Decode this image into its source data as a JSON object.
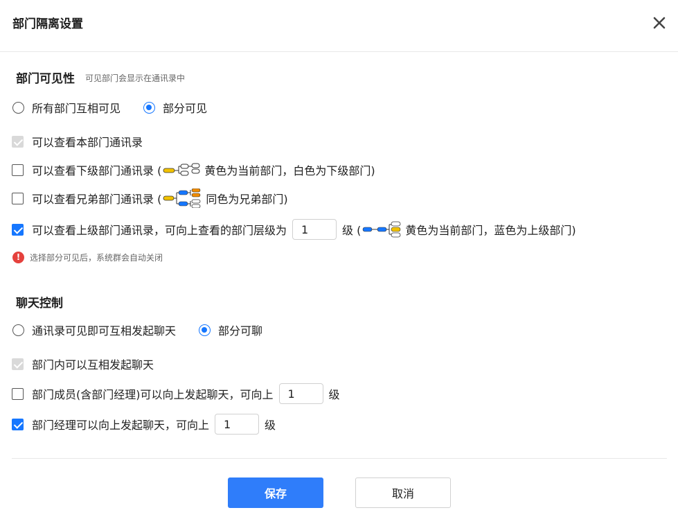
{
  "dialog": {
    "title": "部门隔离设置",
    "close_icon": "close-icon"
  },
  "visibility": {
    "title": "部门可见性",
    "hint": "可见部门会显示在通讯录中",
    "mode_options": [
      {
        "label": "所有部门互相可见",
        "checked": false
      },
      {
        "label": "部分可见",
        "checked": true
      }
    ],
    "options": {
      "own_dept": {
        "label": "可以查看本部门通讯录",
        "checked": true,
        "disabled": true
      },
      "sub_dept": {
        "label": "可以查看下级部门通讯录 (",
        "legend": "黄色为当前部门，白色为下级部门)",
        "checked": false
      },
      "sibling_dept": {
        "label": "可以查看兄弟部门通讯录 (",
        "legend": "同色为兄弟部门)",
        "checked": false
      },
      "upper_dept": {
        "label": "可以查看上级部门通讯录，可向上查看的部门层级为",
        "value": "1",
        "unit": "级 (",
        "legend": "黄色为当前部门，蓝色为上级部门)",
        "checked": true
      }
    },
    "warning": "选择部分可见后，系统群会自动关闭",
    "warning_icon": "exclamation-circle-icon"
  },
  "chat": {
    "title": "聊天控制",
    "mode_options": [
      {
        "label": "通讯录可见即可互相发起聊天",
        "checked": false
      },
      {
        "label": "部分可聊",
        "checked": true
      }
    ],
    "options": {
      "in_dept": {
        "label": "部门内可以互相发起聊天",
        "checked": true,
        "disabled": true
      },
      "member_up": {
        "label": "部门成员(含部门经理)可以向上发起聊天，可向上",
        "value": "1",
        "unit": "级",
        "checked": false
      },
      "manager_up": {
        "label": "部门经理可以向上发起聊天，可向上",
        "value": "1",
        "unit": "级",
        "checked": true
      }
    }
  },
  "footer": {
    "save_label": "保存",
    "cancel_label": "取消"
  },
  "colors": {
    "primary": "#2f7dfa",
    "radio_checked": "#1677ff",
    "current_dept_yellow": "#f2c200",
    "upper_dept_blue": "#1677ff",
    "sibling_orange": "#f08c00",
    "warning_red": "#e5413d"
  }
}
